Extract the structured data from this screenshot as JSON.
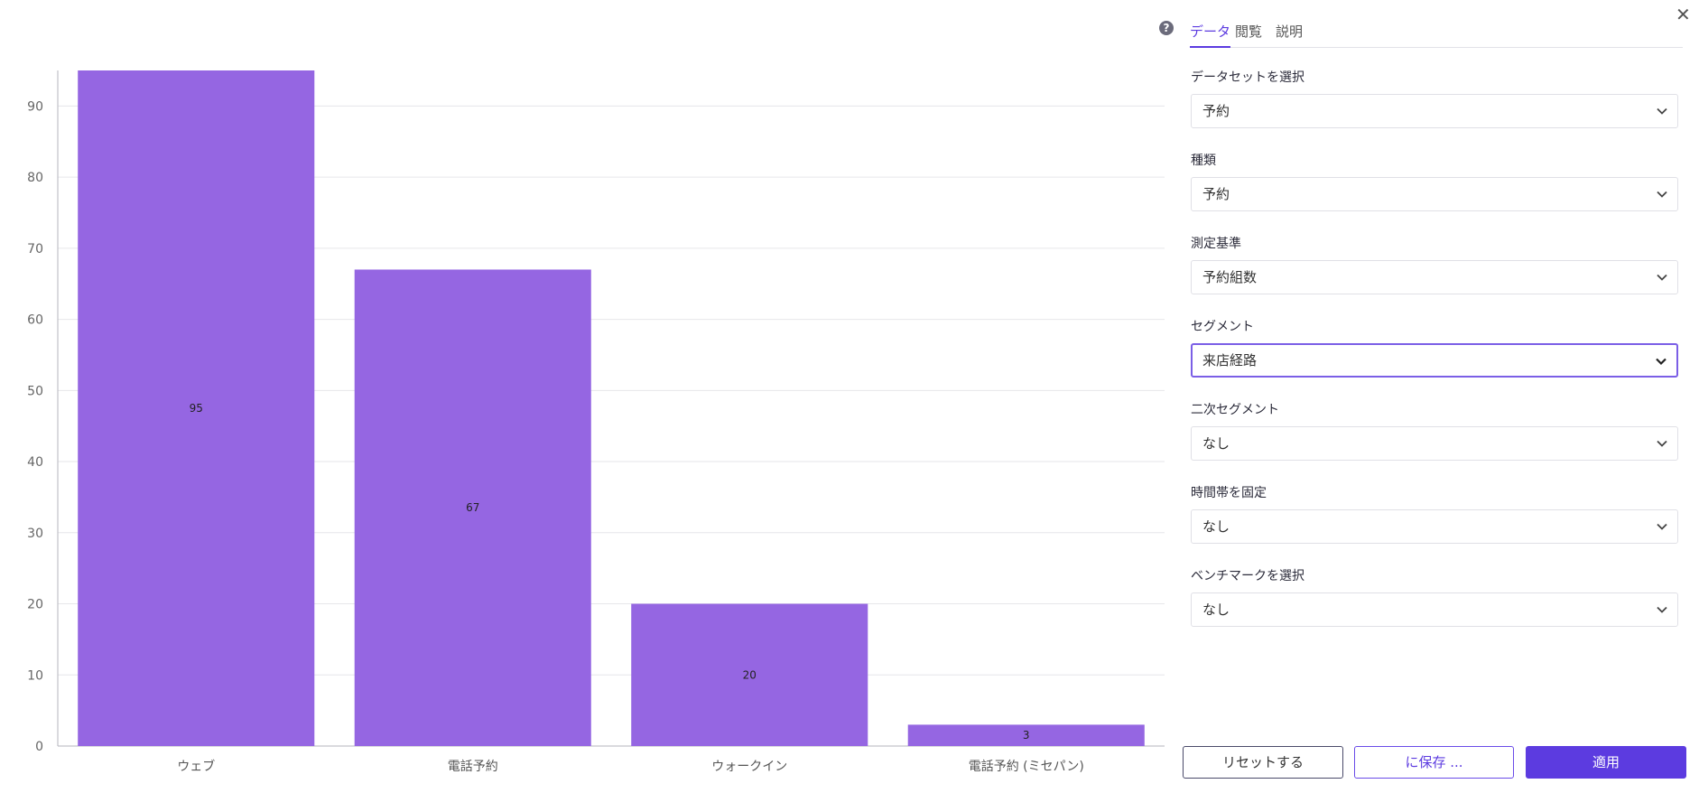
{
  "chart_data": {
    "type": "bar",
    "categories": [
      "ウェブ",
      "電話予約",
      "ウォークイン",
      "電話予約 (ミセパン)"
    ],
    "values": [
      95,
      67,
      20,
      3
    ],
    "value_labels": [
      "95",
      "67",
      "20",
      "3"
    ],
    "ylim": [
      0,
      95
    ],
    "yticks": [
      0,
      10,
      20,
      30,
      40,
      50,
      60,
      70,
      80,
      90
    ],
    "grid": true,
    "bar_color": "#9566e2"
  },
  "panel": {
    "tabs": [
      {
        "label": "データ"
      },
      {
        "label": "閲覧"
      },
      {
        "label": "説明"
      }
    ],
    "fields": [
      {
        "label": "データセットを選択",
        "value": "予約"
      },
      {
        "label": "種類",
        "value": "予約"
      },
      {
        "label": "測定基準",
        "value": "予約組数"
      },
      {
        "label": "セグメント",
        "value": "来店経路"
      },
      {
        "label": "二次セグメント",
        "value": "なし"
      },
      {
        "label": "時間帯を固定",
        "value": "なし"
      },
      {
        "label": "ベンチマークを選択",
        "value": "なし"
      }
    ],
    "buttons": {
      "reset": "リセットする",
      "save": "に保存 ...",
      "apply": "適用"
    },
    "accent_color": "#5c3be0"
  },
  "icons": {
    "help": "question-circle-icon",
    "close": "close-icon",
    "chevron": "chevron-down-icon"
  }
}
